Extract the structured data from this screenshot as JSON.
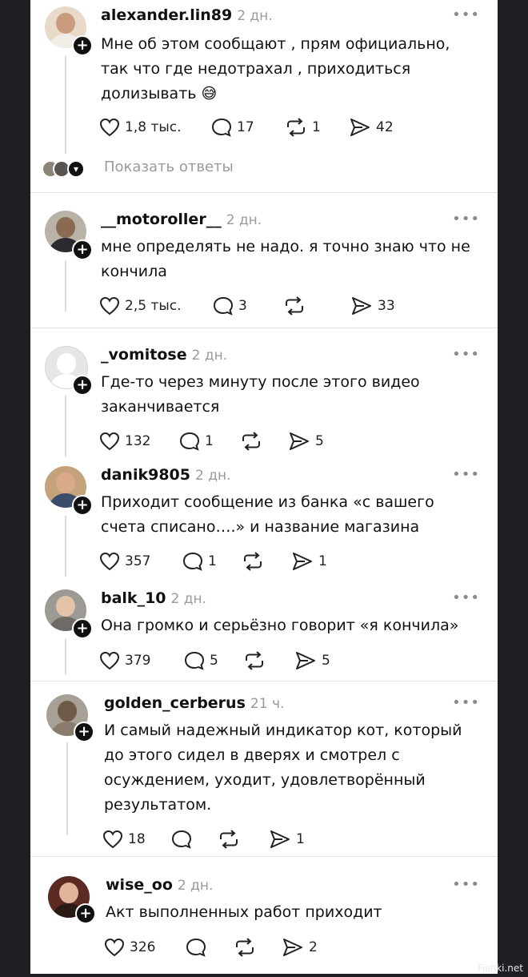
{
  "posts": [
    {
      "username": "alexander.lin89",
      "time": "2 дн.",
      "text": "Мне об этом сообщают , прям официально,\nтак что где недотрахал , приходиться\nдолизывать",
      "emoji": "😅",
      "likes": "1,8 тыс.",
      "comments": "17",
      "reposts": "1",
      "shares": "42"
    },
    {
      "username": "__motoroller__",
      "time": "2 дн.",
      "text": "мне определять не надо. я точно знаю что не\nкончила",
      "likes": "2,5 тыс.",
      "comments": "3",
      "reposts": "",
      "shares": "33"
    },
    {
      "username": "_vomitose",
      "time": "2 дн.",
      "text": "Где-то через минуту после этого видео\nзаканчивается",
      "likes": "132",
      "comments": "1",
      "reposts": "",
      "shares": "5"
    },
    {
      "username": "danik9805",
      "time": "2 дн.",
      "text": "Приходит сообщение из банка «с вашего\nсчета списано….» и название магазина",
      "likes": "357",
      "comments": "1",
      "reposts": "",
      "shares": "1"
    },
    {
      "username": "balk_10",
      "time": "2 дн.",
      "text": "Она громко и серьёзно говорит «я кончила»",
      "likes": "379",
      "comments": "5",
      "reposts": "",
      "shares": "5"
    },
    {
      "username": "golden_cerberus",
      "time": "21 ч.",
      "text": "И самый надежный индикатор  кот, который\nдо этого сидел в дверях и смотрел с\nосуждением, уходит, удовлетворённый\nрезультатом.",
      "likes": "18",
      "comments": "",
      "reposts": "",
      "shares": "1"
    },
    {
      "username": "wise_oo",
      "time": "2 дн.",
      "text": "Акт выполненных работ приходит",
      "likes": "326",
      "comments": "",
      "reposts": "",
      "shares": "2"
    }
  ],
  "show_replies_label": "Показать ответы",
  "more_label": "•••",
  "watermark": "Fishki.net",
  "colors": {
    "background": "#1e1f22",
    "card": "#ffffff",
    "muted": "#9a9a9a",
    "text": "#111111"
  }
}
